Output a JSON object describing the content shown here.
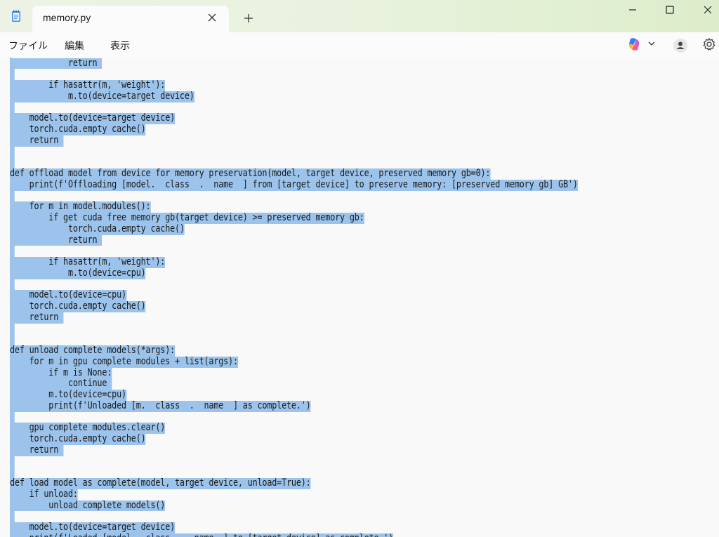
{
  "window": {
    "tab_title": "memory.py",
    "new_tab_label": "+"
  },
  "menu": [
    "ファイル",
    "編集",
    "表示"
  ],
  "editor": {
    "lines": [
      "            return ",
      " ",
      "        if hasattr(m, 'weight'):",
      "            m.to(device=target device)",
      " ",
      "    model.to(device=target device)",
      "    torch.cuda.empty cache()",
      "    return ",
      " ",
      " ",
      "def offload model from device for memory preservation(model, target device, preserved memory gb=0):",
      "    print(f'Offloading [model.  class  .  name  ] from [target device] to preserve memory: [preserved memory gb] GB')",
      " ",
      "    for m in model.modules():",
      "        if get cuda free memory gb(target device) >= preserved memory gb:",
      "            torch.cuda.empty cache()",
      "            return ",
      " ",
      "        if hasattr(m, 'weight'):",
      "            m.to(device=cpu)",
      " ",
      "    model.to(device=cpu)",
      "    torch.cuda.empty cache()",
      "    return ",
      " ",
      " ",
      "def unload complete models(*args):",
      "    for m in gpu complete modules + list(args):",
      "        if m is None:",
      "            continue ",
      "        m.to(device=cpu)",
      "        print(f'Unloaded [m.  class  .  name  ] as complete.')",
      " ",
      "    gpu complete modules.clear()",
      "    torch.cuda.empty cache()",
      "    return ",
      " ",
      " ",
      "def load model as complete(model, target device, unload=True):",
      "    if unload:",
      "        unload complete models()",
      " ",
      "    model.to(device=target device)",
      "    print(f'Loaded [model.  class  .  name  ] to [target device] as complete.')"
    ]
  }
}
